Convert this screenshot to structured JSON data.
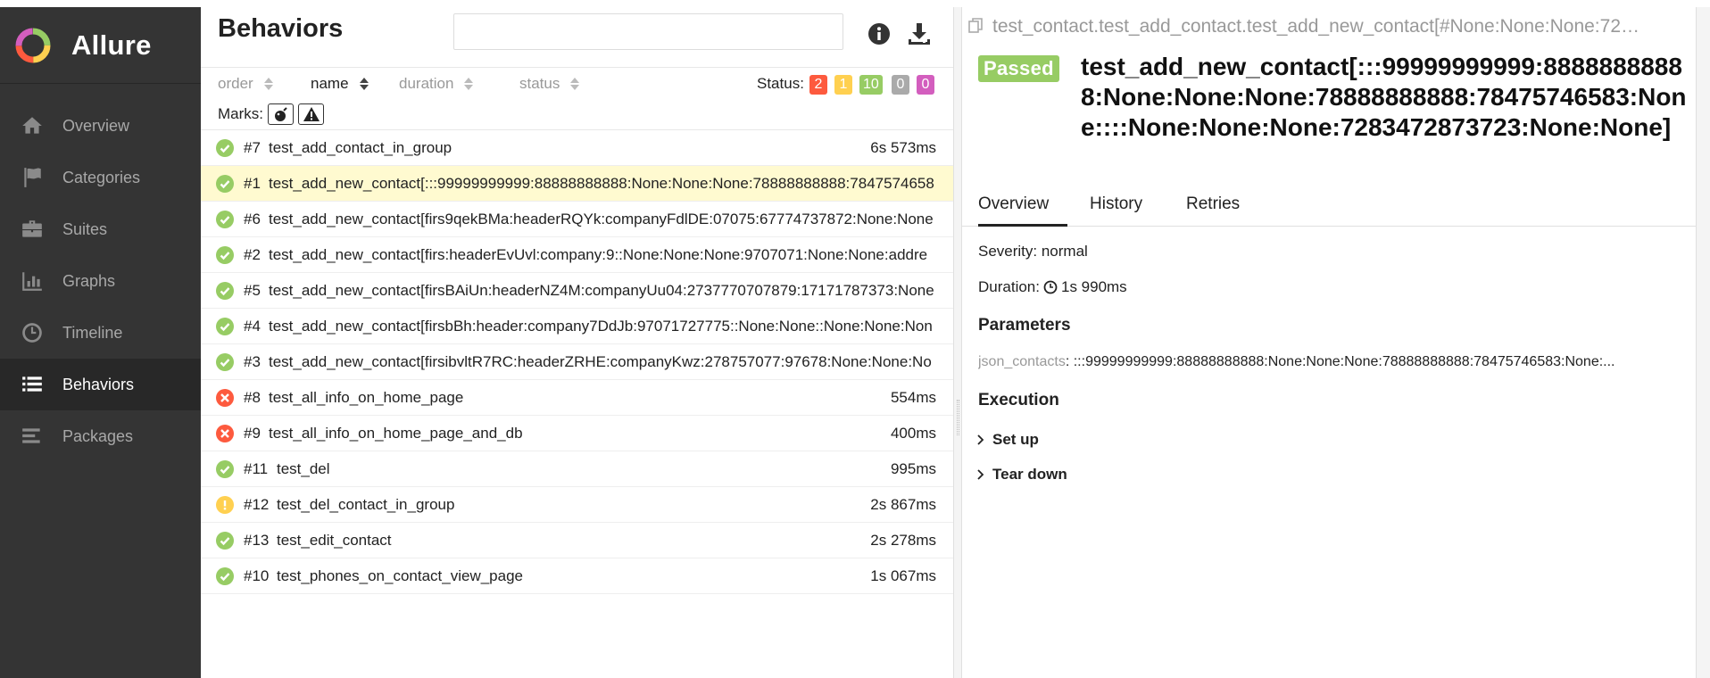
{
  "brand": {
    "name": "Allure"
  },
  "sidebar": {
    "items": [
      {
        "label": "Overview",
        "icon": "home-icon",
        "active": false
      },
      {
        "label": "Categories",
        "icon": "flag-icon",
        "active": false
      },
      {
        "label": "Suites",
        "icon": "briefcase-icon",
        "active": false
      },
      {
        "label": "Graphs",
        "icon": "bar-chart-icon",
        "active": false
      },
      {
        "label": "Timeline",
        "icon": "clock-icon",
        "active": false
      },
      {
        "label": "Behaviors",
        "icon": "list-icon",
        "active": true
      },
      {
        "label": "Packages",
        "icon": "align-left-icon",
        "active": false
      }
    ]
  },
  "tree": {
    "title": "Behaviors",
    "search": {
      "value": "",
      "placeholder": ""
    },
    "sorters": {
      "order": "order",
      "name": "name",
      "duration": "duration",
      "status": "status"
    },
    "status_label": "Status:",
    "status_counts": {
      "failed": "2",
      "broken": "1",
      "passed": "10",
      "skipped": "0",
      "unknown": "0"
    },
    "marks_label": "Marks:",
    "rows": [
      {
        "status": "passed",
        "num": "#7",
        "name": "test_add_contact_in_group",
        "duration": "6s 573ms",
        "selected": false
      },
      {
        "status": "passed",
        "num": "#1",
        "name": "test_add_new_contact[:::99999999999:88888888888:None:None:None:78888888888:7847574658",
        "duration": "",
        "selected": true
      },
      {
        "status": "passed",
        "num": "#6",
        "name": "test_add_new_contact[firs9qekBMa:headerRQYk:companyFdlDE:07075:67774737872:None:None",
        "duration": "",
        "selected": false
      },
      {
        "status": "passed",
        "num": "#2",
        "name": "test_add_new_contact[firs:headerEvUvl:company:9::None:None:None:9707071:None:None:addre",
        "duration": "",
        "selected": false
      },
      {
        "status": "passed",
        "num": "#5",
        "name": "test_add_new_contact[firsBAiUn:headerNZ4M:companyUu04:2737770707879:17171787373:None",
        "duration": "",
        "selected": false
      },
      {
        "status": "passed",
        "num": "#4",
        "name": "test_add_new_contact[firsbBh:header:company7DdJb:97071727775::None:None::None:None:Non",
        "duration": "",
        "selected": false
      },
      {
        "status": "passed",
        "num": "#3",
        "name": "test_add_new_contact[firsibvltR7RC:headerZRHE:companyKwz:278757077:97678:None:None:No",
        "duration": "",
        "selected": false
      },
      {
        "status": "failed",
        "num": "#8",
        "name": "test_all_info_on_home_page",
        "duration": "554ms",
        "selected": false
      },
      {
        "status": "failed",
        "num": "#9",
        "name": "test_all_info_on_home_page_and_db",
        "duration": "400ms",
        "selected": false
      },
      {
        "status": "passed",
        "num": "#11",
        "name": "test_del",
        "duration": "995ms",
        "selected": false
      },
      {
        "status": "broken",
        "num": "#12",
        "name": "test_del_contact_in_group",
        "duration": "2s 867ms",
        "selected": false
      },
      {
        "status": "passed",
        "num": "#13",
        "name": "test_edit_contact",
        "duration": "2s 278ms",
        "selected": false
      },
      {
        "status": "passed",
        "num": "#10",
        "name": "test_phones_on_contact_view_page",
        "duration": "1s 067ms",
        "selected": false
      }
    ]
  },
  "details": {
    "full_name": "test_contact.test_add_contact.test_add_new_contact[#None:None:None:72…",
    "status_badge": "Passed",
    "title": "test_add_new_contact[:::99999999999:88888888888:None:None:None:78888888888:78475746583:None::::None:None:None:7283472873723:None:None]",
    "tabs": [
      "Overview",
      "History",
      "Retries"
    ],
    "severity": "Severity: normal",
    "duration_label": "Duration:",
    "duration_value": "1s 990ms",
    "parameters_title": "Parameters",
    "param_key": "json_contacts",
    "param_value": ": :::99999999999:88888888888:None:None:None:78888888888:78475746583:None:...",
    "execution_title": "Execution",
    "setup_label": "Set up",
    "teardown_label": "Tear down"
  },
  "colors": {
    "failed": "#fd5a3e",
    "broken": "#ffd050",
    "passed": "#97cc64",
    "skipped": "#aaaaaa",
    "unknown": "#d35ebe",
    "sidebar_bg": "#343434",
    "selected_row": "#fffad0",
    "active_nav_marker": "#6fb4ee"
  }
}
